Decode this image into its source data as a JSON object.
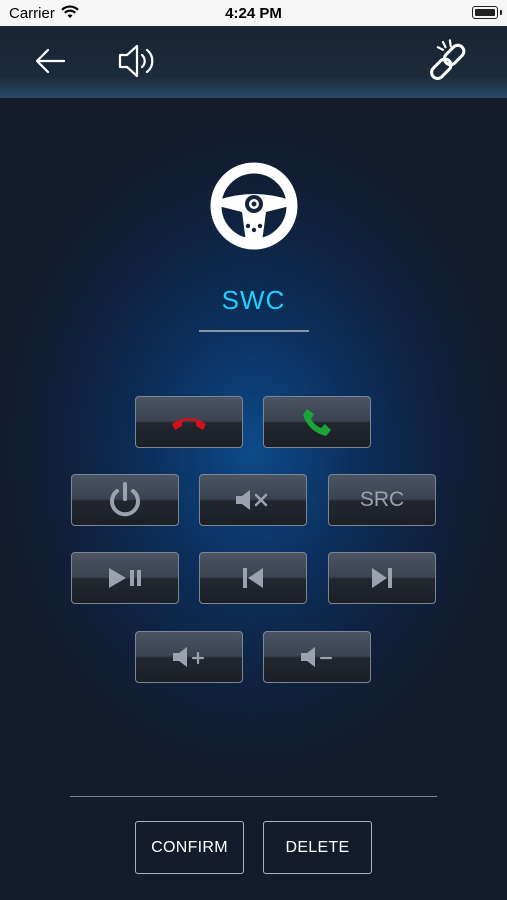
{
  "status_bar": {
    "carrier": "Carrier",
    "time": "4:24 PM"
  },
  "nav": {
    "back_icon": "arrow-left-icon",
    "sound_icon": "speaker-icon",
    "link_icon": "broken-link-icon"
  },
  "screen": {
    "title": "SWC",
    "icon": "steering-wheel-icon"
  },
  "keys": {
    "src_label": "SRC",
    "end_call_icon": "phone-hangup-icon",
    "answer_call_icon": "phone-answer-icon",
    "power_icon": "power-icon",
    "mute_icon": "mute-icon",
    "play_pause_icon": "play-pause-icon",
    "prev_icon": "skip-previous-icon",
    "next_icon": "skip-next-icon",
    "vol_up_icon": "volume-up-icon",
    "vol_down_icon": "volume-down-icon"
  },
  "actions": {
    "confirm": "CONFIRM",
    "delete": "DELETE"
  },
  "colors": {
    "accent": "#1fd0ff",
    "end_call": "#d0101a",
    "answer_call": "#1aa63a"
  }
}
